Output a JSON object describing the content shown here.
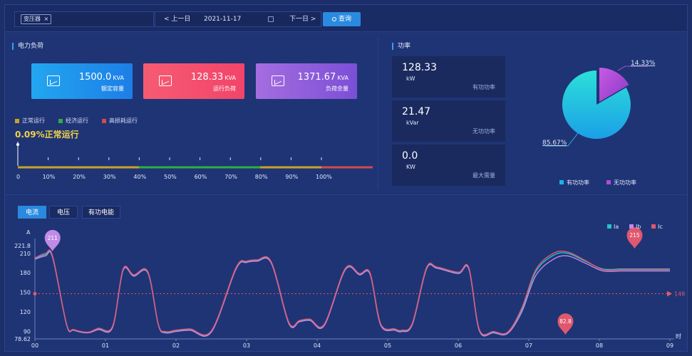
{
  "topbar": {
    "tag_label": "变压器",
    "tag_close": "×",
    "prev_day": "< 上一日",
    "date": "2021-11-17",
    "next_day": "下一日 >",
    "query_label": "查询"
  },
  "load_panel": {
    "title": "电力负荷",
    "cards": [
      {
        "value": "1500.0",
        "unit": "KVA",
        "label": "额定容量"
      },
      {
        "value": "128.33",
        "unit": "KVA",
        "label": "运行负荷"
      },
      {
        "value": "1371.67",
        "unit": "KVA",
        "label": "负荷余量"
      }
    ],
    "legend": [
      "正常运行",
      "经济运行",
      "高损耗运行"
    ],
    "status_text": "0.09%正常运行",
    "scale_labels": [
      "0",
      "10%",
      "20%",
      "30%",
      "40%",
      "50%",
      "60%",
      "70%",
      "80%",
      "90%",
      "100%"
    ],
    "load_percent": 0.09
  },
  "power_panel": {
    "title": "功率",
    "items": [
      {
        "value": "128.33",
        "unit": "kW",
        "name": "有功功率"
      },
      {
        "value": "21.47",
        "unit": "kVar",
        "name": "无功功率"
      },
      {
        "value": "0.0",
        "unit": "KW",
        "name": "最大需量"
      }
    ],
    "pie_labels": [
      "14.33%",
      "85.67%"
    ],
    "legend": [
      "有功功率",
      "无功功率"
    ]
  },
  "tabs": [
    "电流",
    "电压",
    "有功电能"
  ],
  "colors": {
    "ia": "#22c3c9",
    "ib": "#c08be6",
    "ic": "#e0586f",
    "accent": "#2a8ae0",
    "active_power": "#19b3e6",
    "reactive_power": "#b04ad6"
  },
  "chart_data": {
    "type": "line",
    "ylabel": "A",
    "xlabel": "时",
    "y_tick_labels": [
      "221.8",
      "210",
      "180",
      "150",
      "120",
      "90",
      "78.62"
    ],
    "x_tick_labels": [
      "00",
      "01",
      "02",
      "03",
      "04",
      "05",
      "06",
      "07",
      "08",
      "09"
    ],
    "ylim": [
      78.62,
      221.8
    ],
    "legend": [
      "Ia",
      "Ib",
      "Ic"
    ],
    "markers": {
      "max_left": "211",
      "min": "82.8",
      "max_right": "215",
      "avg": "148"
    },
    "avg_value": 148,
    "x": [
      0,
      0.15,
      0.25,
      0.45,
      0.55,
      0.75,
      0.9,
      1.1,
      1.25,
      1.4,
      1.6,
      1.75,
      1.85,
      2.0,
      2.2,
      2.5,
      2.85,
      3.0,
      3.15,
      3.35,
      3.6,
      3.75,
      3.9,
      4.1,
      4.4,
      4.6,
      4.75,
      4.9,
      5.1,
      5.2,
      5.35,
      5.55,
      5.7,
      6.0,
      6.15,
      6.3,
      6.5,
      6.7,
      6.9,
      7.1,
      7.35,
      7.55,
      7.8,
      8.05,
      8.3,
      8.5,
      8.7,
      9.0
    ],
    "series": [
      {
        "name": "Ia",
        "values": [
          202,
          208,
          205,
          100,
          92,
          88,
          94,
          97,
          185,
          176,
          181,
          100,
          89,
          91,
          93,
          90,
          187,
          197,
          199,
          196,
          103,
          106,
          108,
          100,
          186,
          178,
          179,
          101,
          93,
          91,
          102,
          187,
          188,
          180,
          187,
          92,
          89,
          88,
          123,
          182,
          207,
          210,
          198,
          186,
          186,
          186,
          186,
          186
        ]
      },
      {
        "name": "Ib",
        "values": [
          201,
          206,
          204,
          100,
          92,
          88,
          93,
          96,
          184,
          175,
          180,
          100,
          88,
          90,
          92,
          89,
          186,
          196,
          198,
          195,
          102,
          105,
          107,
          99,
          185,
          177,
          178,
          100,
          92,
          90,
          101,
          186,
          187,
          179,
          186,
          91,
          88,
          87,
          120,
          176,
          201,
          206,
          195,
          183,
          183,
          183,
          183,
          183
        ]
      },
      {
        "name": "Ic",
        "values": [
          203,
          210,
          206,
          101,
          93,
          89,
          95,
          98,
          186,
          177,
          182,
          101,
          90,
          92,
          94,
          91,
          188,
          198,
          200,
          197,
          104,
          107,
          109,
          101,
          187,
          179,
          180,
          102,
          94,
          92,
          103,
          188,
          189,
          181,
          188,
          93,
          90,
          89,
          126,
          185,
          210,
          212,
          199,
          185,
          185,
          185,
          185,
          185
        ]
      }
    ]
  }
}
